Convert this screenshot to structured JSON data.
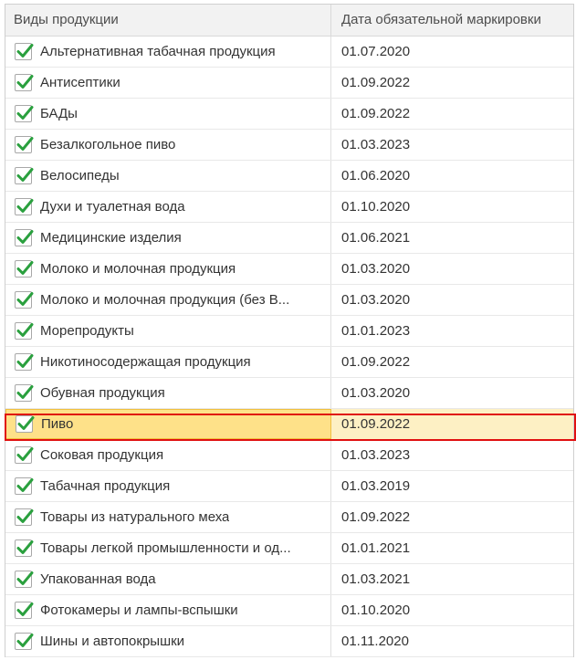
{
  "table": {
    "header": {
      "col1": "Виды продукции",
      "col2": "Дата обязательной маркировки"
    },
    "rows": [
      {
        "name": "Альтернативная табачная продукция",
        "date": "01.07.2020",
        "checked": true
      },
      {
        "name": "Антисептики",
        "date": "01.09.2022",
        "checked": true
      },
      {
        "name": "БАДы",
        "date": "01.09.2022",
        "checked": true
      },
      {
        "name": "Безалкогольное пиво",
        "date": "01.03.2023",
        "checked": true
      },
      {
        "name": "Велосипеды",
        "date": "01.06.2020",
        "checked": true
      },
      {
        "name": "Духи и туалетная вода",
        "date": "01.10.2020",
        "checked": true
      },
      {
        "name": "Медицинские изделия",
        "date": "01.06.2021",
        "checked": true
      },
      {
        "name": "Молоко и молочная продукция",
        "date": "01.03.2020",
        "checked": true
      },
      {
        "name": "Молоко и молочная продукция (без В...",
        "date": "01.03.2020",
        "checked": true
      },
      {
        "name": "Морепродукты",
        "date": "01.01.2023",
        "checked": true
      },
      {
        "name": "Никотиносодержащая продукция",
        "date": "01.09.2022",
        "checked": true
      },
      {
        "name": "Обувная продукция",
        "date": "01.03.2020",
        "checked": true
      },
      {
        "name": "Пиво",
        "date": "01.09.2022",
        "checked": true,
        "selected": true
      },
      {
        "name": "Соковая продукция",
        "date": "01.03.2023",
        "checked": true
      },
      {
        "name": "Табачная продукция",
        "date": "01.03.2019",
        "checked": true
      },
      {
        "name": "Товары из натурального меха",
        "date": "01.09.2022",
        "checked": true
      },
      {
        "name": "Товары легкой промышленности и од...",
        "date": "01.01.2021",
        "checked": true
      },
      {
        "name": "Упакованная вода",
        "date": "01.03.2021",
        "checked": true
      },
      {
        "name": "Фотокамеры и лампы-вспышки",
        "date": "01.10.2020",
        "checked": true
      },
      {
        "name": "Шины и автопокрышки",
        "date": "01.11.2020",
        "checked": true
      }
    ]
  },
  "colors": {
    "check": "#2aa03e",
    "selected_row": "#fdf0c4",
    "selected_cell": "#fee189",
    "highlight_border": "#e01010"
  },
  "icons": {
    "checkbox": "checkmark-icon"
  }
}
